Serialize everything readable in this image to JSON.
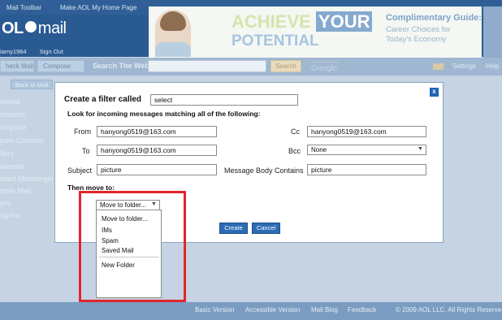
{
  "topbar": {
    "links": [
      "Mail Toolbar",
      "Make AOL My Home Page"
    ]
  },
  "brand": {
    "logo_left": "OL",
    "logo_right": "mail"
  },
  "user": {
    "screen_name": "iamy1984",
    "sign_out": "Sign Out"
  },
  "ad": {
    "headline_1": "ACHIEVE",
    "headline_1b": "YOUR",
    "headline_2": "POTENTIAL",
    "guide_title": "Complimentary Guide:",
    "guide_line1": "Career Choices for",
    "guide_line2": "Today's Economy"
  },
  "toolbar": {
    "check_mail": "heck Mail",
    "compose": "Compose",
    "search_label": "Search The Web",
    "search_button": "Search",
    "enhanced_by": "enhanced by",
    "google": "Google",
    "settings": "Settings",
    "help": "Help"
  },
  "sidebar": {
    "back_button": "Back to Mail",
    "items": [
      "eneral",
      "ccounts",
      "ompose",
      "pam Controls",
      "lters",
      "alendar",
      "stant Messenger",
      "obile Mail",
      "ync",
      "ug-ins"
    ]
  },
  "footer": {
    "links": [
      "Basic Version",
      "Accessible Version",
      "Mail Blog",
      "Feedback"
    ],
    "copyright": "© 2009 AOL LLC. All Rights Reserve"
  },
  "modal": {
    "close_glyph": "x",
    "title": "Create a filter called",
    "filter_name": "select",
    "instruction": "Look for incoming messages matching all of the following:",
    "from_label": "From",
    "from_value": "hanyong0519@163.com",
    "to_label": "To",
    "to_value": "hanyong0519@163.com",
    "subject_label": "Subject",
    "subject_value": "picture",
    "cc_label": "Cc",
    "cc_value": "hanyong0519@163.com",
    "bcc_label": "Bcc",
    "bcc_value": "None",
    "body_label": "Message Body Contains",
    "body_value": "picture",
    "then_label": "Then move to:",
    "folder_select": "Move to folder...",
    "create_button": "Create",
    "cancel_button": "Cancel"
  },
  "folder_menu": {
    "items": [
      "Move to folder...",
      "IMs",
      "Spam",
      "Saved Mail"
    ],
    "extra": "New Folder"
  },
  "colors": {
    "accent": "#2b6cb3",
    "highlight": "#e0262b",
    "dim_background": "#c5d3e2"
  }
}
